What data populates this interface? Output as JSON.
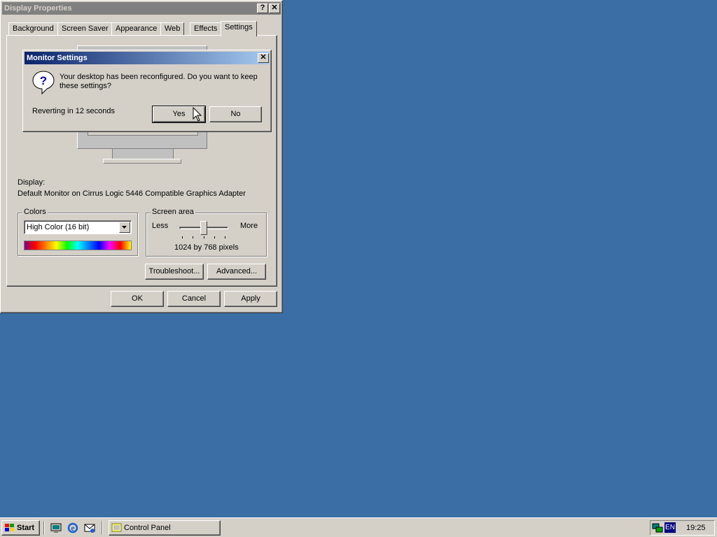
{
  "display_properties": {
    "title": "Display Properties",
    "help_button": "?",
    "close_button": "✕",
    "tabs": [
      {
        "label": "Background"
      },
      {
        "label": "Screen Saver"
      },
      {
        "label": "Appearance"
      },
      {
        "label": "Web"
      },
      {
        "label": "Effects"
      },
      {
        "label": "Settings"
      }
    ],
    "active_tab": "Settings",
    "display_label": "Display:",
    "display_value": "Default Monitor on Cirrus Logic 5446 Compatible Graphics Adapter",
    "colors": {
      "group_label": "Colors",
      "selected": "High Color (16 bit)"
    },
    "screen_area": {
      "group_label": "Screen area",
      "less": "Less",
      "more": "More",
      "resolution": "1024 by 768 pixels",
      "slider_level": 0.5
    },
    "troubleshoot_button": "Troubleshoot...",
    "advanced_button": "Advanced...",
    "ok_button": "OK",
    "cancel_button": "Cancel",
    "apply_button": "Apply"
  },
  "monitor_settings": {
    "title": "Monitor Settings",
    "message": "Your desktop has been reconfigured.  Do you want to keep these settings?",
    "countdown": "Reverting in 12 seconds",
    "yes_button": "Yes",
    "no_button": "No",
    "icon": "question-icon"
  },
  "taskbar": {
    "start_label": "Start",
    "quicklaunch": [
      "show-desktop-icon",
      "internet-explorer-icon",
      "outlook-express-icon"
    ],
    "task_button": "Control Panel",
    "tray_language": "EN",
    "clock": "19:25"
  },
  "colors": {
    "desktop": "#3a6ea5",
    "titlebar_active_start": "#0a246a",
    "titlebar_active_end": "#a6caf0",
    "titlebar_inactive": "#808080",
    "face": "#d4d0c8"
  }
}
